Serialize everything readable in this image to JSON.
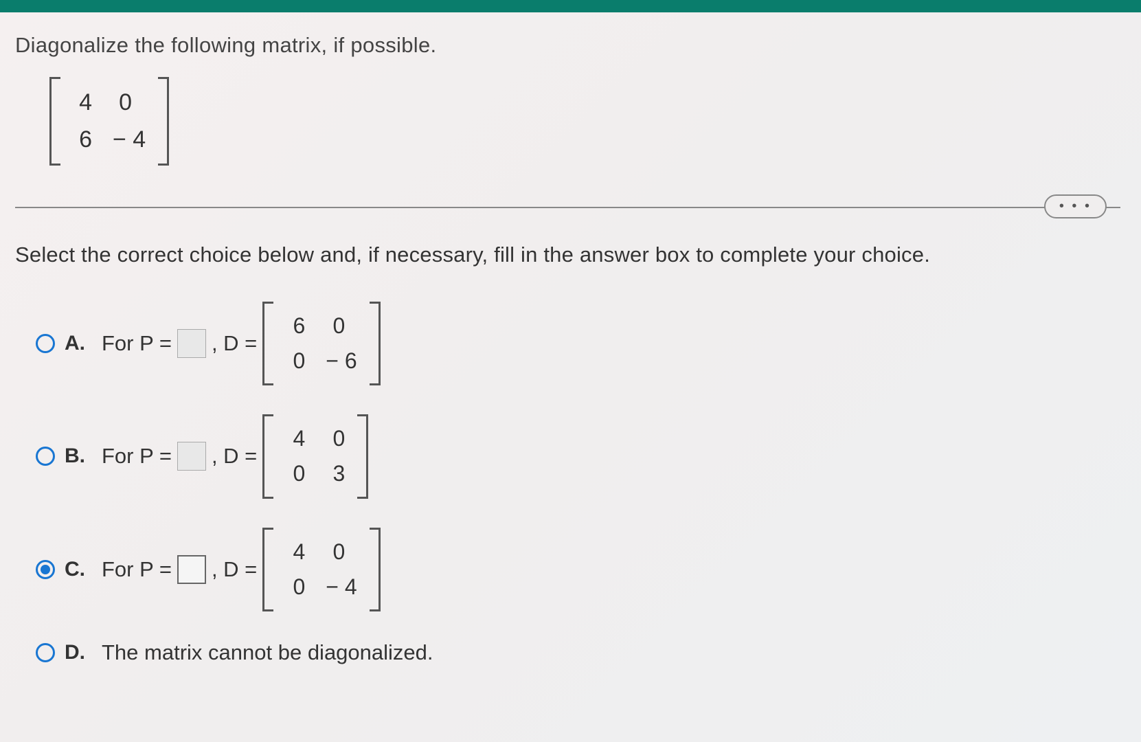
{
  "question": "Diagonalize the following matrix, if possible.",
  "matrix": {
    "r1c1": "4",
    "r1c2": "0",
    "r2c1": "6",
    "r2c2": "− 4"
  },
  "instruction": "Select the correct choice below and, if necessary, fill in the answer box to complete your choice.",
  "ellipsis": "• • •",
  "choices": {
    "a": {
      "letter": "A.",
      "prefix": "For P =",
      "mid": ", D =",
      "m": {
        "r1c1": "6",
        "r1c2": "0",
        "r2c1": "0",
        "r2c2": "− 6"
      }
    },
    "b": {
      "letter": "B.",
      "prefix": "For P =",
      "mid": ", D =",
      "m": {
        "r1c1": "4",
        "r1c2": "0",
        "r2c1": "0",
        "r2c2": "3"
      }
    },
    "c": {
      "letter": "C.",
      "prefix": "For P =",
      "mid": ", D =",
      "m": {
        "r1c1": "4",
        "r1c2": "0",
        "r2c1": "0",
        "r2c2": "− 4"
      }
    },
    "d": {
      "letter": "D.",
      "text": "The matrix cannot be diagonalized."
    }
  }
}
